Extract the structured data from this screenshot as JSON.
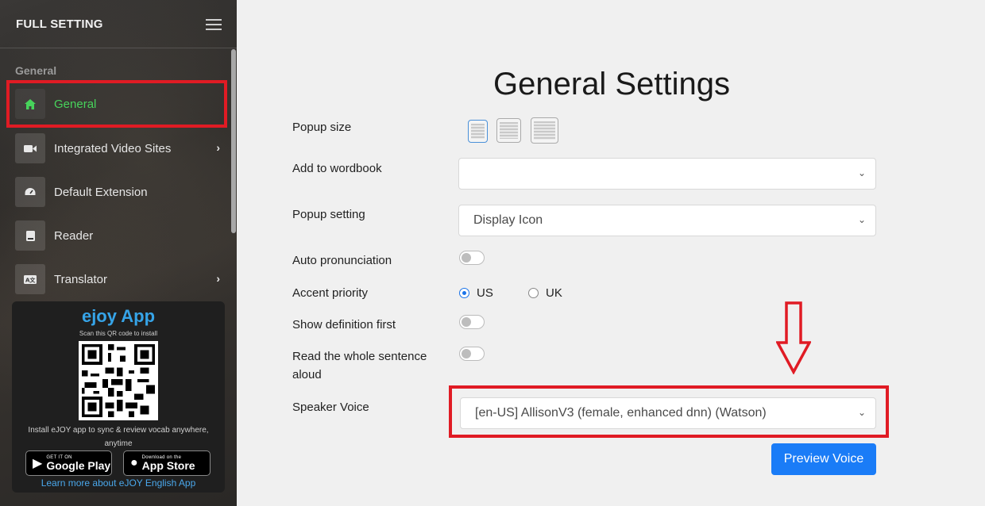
{
  "sidebar": {
    "title": "FULL SETTING",
    "section": "General",
    "items": [
      {
        "label": "General",
        "icon": "home-icon",
        "active": true,
        "has_submenu": false
      },
      {
        "label": "Integrated Video Sites",
        "icon": "video-camera-icon",
        "active": false,
        "has_submenu": true
      },
      {
        "label": "Default Extension",
        "icon": "speedometer-icon",
        "active": false,
        "has_submenu": false
      },
      {
        "label": "Reader",
        "icon": "book-icon",
        "active": false,
        "has_submenu": false
      },
      {
        "label": "Translator",
        "icon": "translate-icon",
        "active": false,
        "has_submenu": true
      }
    ]
  },
  "promo": {
    "brand": "ejoy App",
    "scan_text": "Scan this QR code to install",
    "description": "Install eJOY app to sync & review vocab anywhere, anytime",
    "google_small": "GET IT ON",
    "google_big": "Google Play",
    "apple_small": "Download on the",
    "apple_big": "App Store",
    "learn_more": "Learn more about eJOY English App"
  },
  "main": {
    "title": "General Settings",
    "popup_size_label": "Popup size",
    "wordbook_label": "Add to wordbook",
    "wordbook_value": "",
    "popup_setting_label": "Popup setting",
    "popup_setting_value": "Display Icon",
    "auto_pron_label": "Auto pronunciation",
    "auto_pron_on": false,
    "accent_label": "Accent priority",
    "accent_options": [
      "US",
      "UK"
    ],
    "accent_selected": "US",
    "show_def_label": "Show definition first",
    "show_def_on": false,
    "read_sentence_label_1": "Read the whole sentence",
    "read_sentence_label_2": "aloud",
    "read_sentence_on": false,
    "speaker_voice_label": "Speaker Voice",
    "speaker_voice_value": "[en-US] AllisonV3 (female, enhanced dnn) (Watson)",
    "preview_button": "Preview Voice"
  },
  "colors": {
    "accent_green": "#47d35b",
    "highlight_red": "#e01b24",
    "primary_blue": "#1a7cf7",
    "brand_blue": "#36a4e8"
  }
}
